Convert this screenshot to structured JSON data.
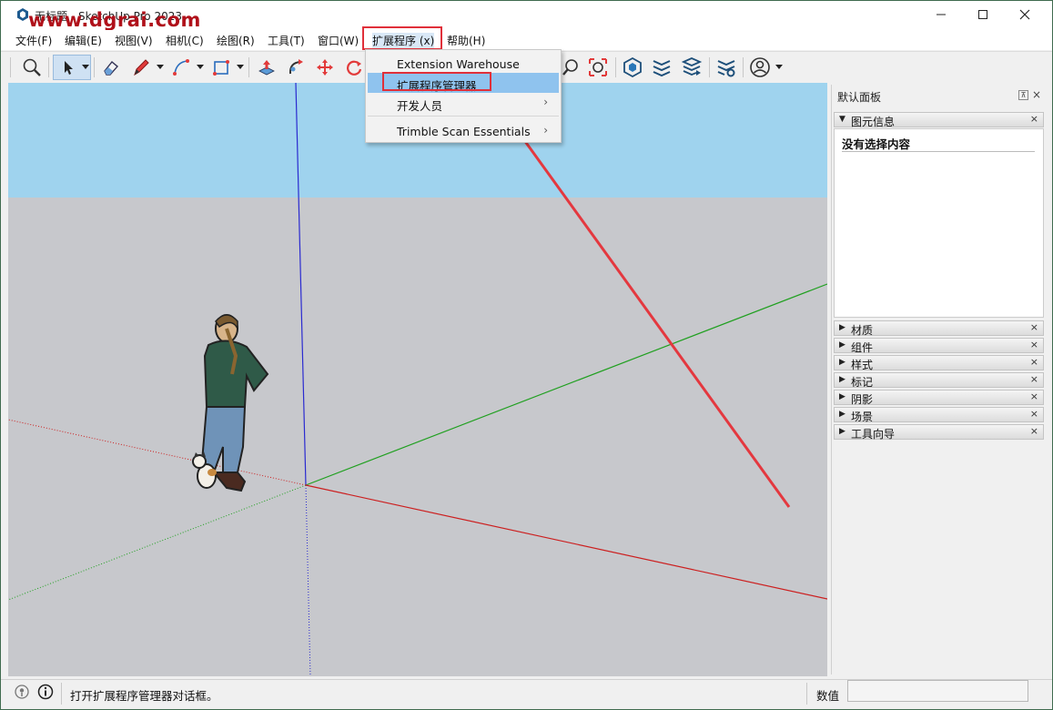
{
  "window": {
    "title": "无标题 - SketchUp Pro 2023",
    "watermark": "www.dgrai.com"
  },
  "menubar": {
    "items": [
      {
        "label": "文件(F)"
      },
      {
        "label": "编辑(E)"
      },
      {
        "label": "视图(V)"
      },
      {
        "label": "相机(C)"
      },
      {
        "label": "绘图(R)"
      },
      {
        "label": "工具(T)"
      },
      {
        "label": "窗口(W)"
      },
      {
        "label": "扩展程序 (x)"
      },
      {
        "label": "帮助(H)"
      }
    ]
  },
  "dropdown": {
    "items": [
      {
        "label": "Extension Warehouse",
        "submenu": false
      },
      {
        "label": "扩展程序管理器",
        "submenu": false,
        "highlighted": true
      },
      {
        "label": "开发人员",
        "submenu": true
      },
      {
        "label": "Trimble Scan Essentials",
        "submenu": true
      }
    ]
  },
  "toolbar": {
    "icons": [
      "zoom-icon",
      "select-icon",
      "eraser-icon",
      "pencil-icon",
      "arc-icon",
      "rectangle-icon",
      "push-pull-icon",
      "follow-me-icon",
      "move-icon",
      "rotate-icon",
      "zoom-window-icon",
      "zoom-extents-icon",
      "warehouse-icon",
      "extension-warehouse-icon",
      "send-to-layout-icon",
      "extension-manager-icon",
      "account-icon"
    ]
  },
  "panel": {
    "title": "默认面板",
    "entity_info": {
      "label": "图元信息",
      "empty_text": "没有选择内容"
    },
    "sections": [
      {
        "label": "材质"
      },
      {
        "label": "组件"
      },
      {
        "label": "样式"
      },
      {
        "label": "标记"
      },
      {
        "label": "阴影"
      },
      {
        "label": "场景"
      },
      {
        "label": "工具向导"
      }
    ]
  },
  "statusbar": {
    "message": "打开扩展程序管理器对话框。",
    "measure_label": "数值",
    "measure_value": ""
  },
  "colors": {
    "sky": "#9fd3ee",
    "ground": "#c7c8cc",
    "highlight": "#e0303a",
    "menu_selected": "#8fc3ee"
  }
}
